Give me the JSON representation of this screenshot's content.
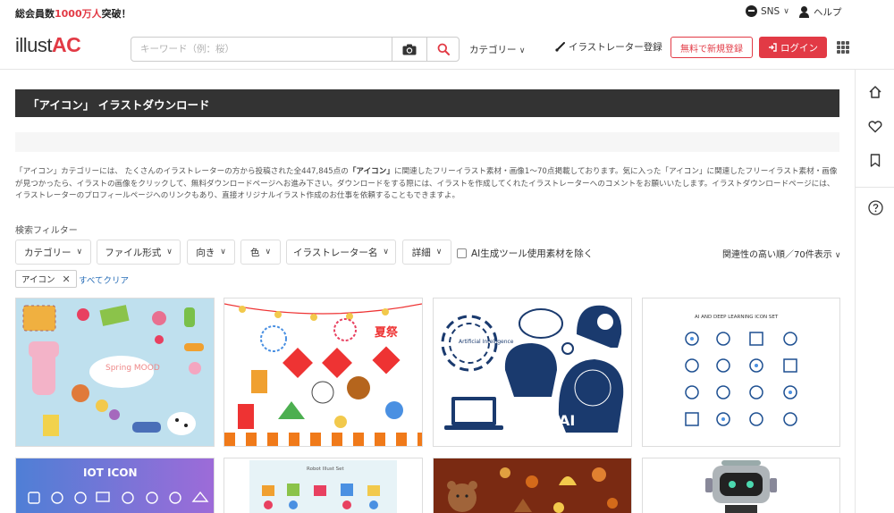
{
  "topbar": {
    "member_prefix": "総会員数",
    "member_count": "1000万人",
    "member_suffix": "突破！",
    "sns_label": "SNS",
    "help_label": "ヘルプ"
  },
  "header": {
    "logo_text": "illust",
    "logo_accent": "AC",
    "search_placeholder": "キーワード（例：桜）",
    "category_label": "カテゴリー",
    "illustrator_register": "イラストレーター登録",
    "free_register": "無料で新規登録",
    "login": "ログイン"
  },
  "page": {
    "title": "「アイコン」 イラストダウンロード",
    "description_1": "「アイコン」カテゴリーには、 たくさんのイラストレーターの方から投稿された全447,845点の",
    "description_bold": "「アイコン」",
    "description_2": "に関連したフリーイラスト素材・画像1〜70点掲載しております。気に入った「アイコン」に関連したフリーイラスト素材・画像が見つかったら、イラストの画像をクリックして、無料ダウンロードページへお進み下さい。ダウンロードをする際には、イラストを作成してくれたイラストレーターへのコメントをお願いいたします。イラストダウンロードページには、イラストレーターのプロフィールページへのリンクもあり、直接オリジナルイラスト作成のお仕事を依頼することもできますよ。"
  },
  "filters": {
    "label": "検索フィルター",
    "buttons": [
      "カテゴリー",
      "ファイル形式",
      "向き",
      "色",
      "イラストレーター名",
      "詳細"
    ],
    "ai_exclude": "AI生成ツール使用素材を除く",
    "sort": "関連性の高い順／70件表示",
    "active_tag": "アイコン",
    "clear_all": "すべてクリア"
  },
  "thumbnails": {
    "t1_text": "Spring MOOD",
    "t2_text": "夏祭",
    "t3_text1": "Artificial Intelligence",
    "t3_text2": "AI",
    "t4_title": "AI AND DEEP LEARNING ICON SET",
    "t5_title": "IOT ICON",
    "t6_title": "Robot Illust Set"
  },
  "colors": {
    "accent": "#e23a45",
    "titlebar": "#333333",
    "link": "#2a6fb8"
  }
}
